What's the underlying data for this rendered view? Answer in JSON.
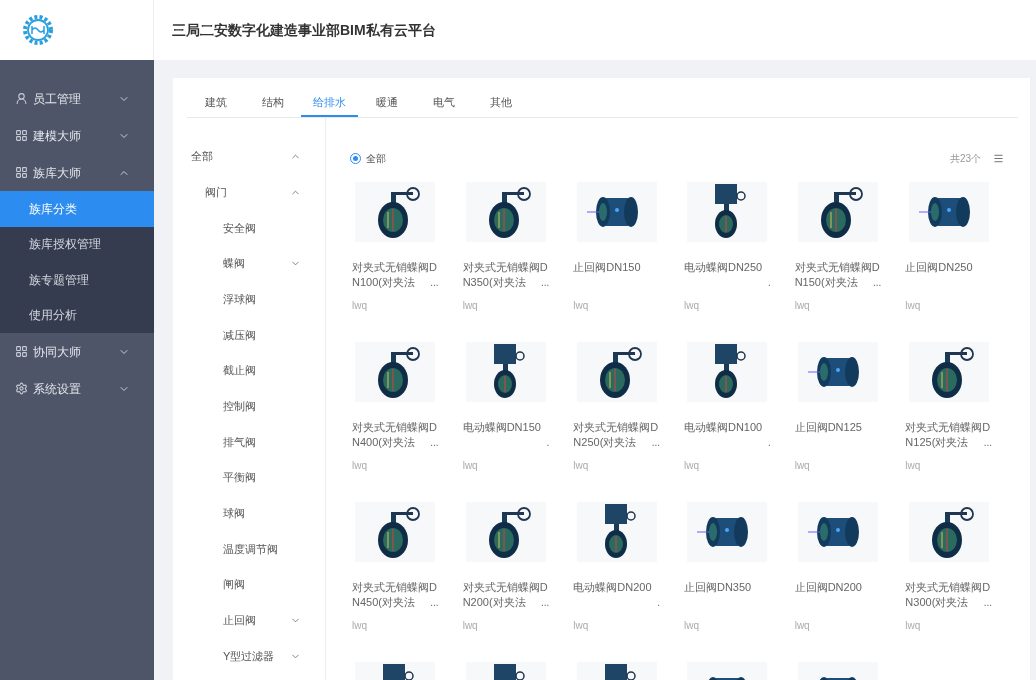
{
  "header": {
    "title": "三局二安数字化建造事业部BIM私有云平台"
  },
  "sidebar": {
    "items": [
      {
        "label": "员工管理",
        "kind": "user",
        "expanded": false
      },
      {
        "label": "建模大师",
        "kind": "grid",
        "expanded": false
      },
      {
        "label": "族库大师",
        "kind": "grid",
        "expanded": true,
        "children": [
          {
            "label": "族库分类",
            "selected": true
          },
          {
            "label": "族库授权管理",
            "selected": false
          },
          {
            "label": "族专题管理",
            "selected": false
          },
          {
            "label": "使用分析",
            "selected": false
          }
        ]
      },
      {
        "label": "协同大师",
        "kind": "grid",
        "expanded": false
      },
      {
        "label": "系统设置",
        "kind": "gear",
        "expanded": false
      }
    ]
  },
  "tabs": [
    {
      "label": "建筑",
      "selected": false
    },
    {
      "label": "结构",
      "selected": false
    },
    {
      "label": "给排水",
      "selected": true
    },
    {
      "label": "暖通",
      "selected": false
    },
    {
      "label": "电气",
      "selected": false
    },
    {
      "label": "其他",
      "selected": false
    }
  ],
  "tree": {
    "label": "全部",
    "expanded": true,
    "children": [
      {
        "label": "阀门",
        "expanded": true,
        "children": [
          {
            "label": "安全阀",
            "kind": "leaf"
          },
          {
            "label": "蝶阀",
            "kind": "group",
            "expanded": false
          },
          {
            "label": "浮球阀",
            "kind": "leaf"
          },
          {
            "label": "减压阀",
            "kind": "leaf"
          },
          {
            "label": "截止阀",
            "kind": "leaf"
          },
          {
            "label": "控制阀",
            "kind": "leaf"
          },
          {
            "label": "排气阀",
            "kind": "leaf"
          },
          {
            "label": "平衡阀",
            "kind": "leaf"
          },
          {
            "label": "球阀",
            "kind": "leaf"
          },
          {
            "label": "温度调节阀",
            "kind": "leaf"
          },
          {
            "label": "闸阀",
            "kind": "leaf"
          },
          {
            "label": "止回阀",
            "kind": "group",
            "expanded": false
          },
          {
            "label": "Y型过滤器",
            "kind": "group",
            "expanded": false
          }
        ]
      }
    ]
  },
  "filter": {
    "label": "全部",
    "selected": true
  },
  "count": "共23个",
  "items": [
    {
      "line1": "对夹式无销蝶阀D",
      "line2": "N100(对夹法",
      "more": "...",
      "author": "lwq"
    },
    {
      "line1": "对夹式无销蝶阀D",
      "line2": "N350(对夹法",
      "more": "...",
      "author": "lwq"
    },
    {
      "line1": "止回阀DN150",
      "author": "lwq"
    },
    {
      "line1": "电动蝶阀DN250",
      "more": ".",
      "author": "lwq"
    },
    {
      "line1": "对夹式无销蝶阀D",
      "line2": "N150(对夹法",
      "more": "...",
      "author": "lwq"
    },
    {
      "line1": "止回阀DN250",
      "author": "lwq"
    },
    {
      "line1": "对夹式无销蝶阀D",
      "line2": "N400(对夹法",
      "more": "...",
      "author": "lwq"
    },
    {
      "line1": "电动蝶阀DN150",
      "more": ".",
      "author": "lwq"
    },
    {
      "line1": "对夹式无销蝶阀D",
      "line2": "N250(对夹法",
      "more": "...",
      "author": "lwq"
    },
    {
      "line1": "电动蝶阀DN100",
      "more": ".",
      "author": "lwq"
    },
    {
      "line1": "止回阀DN125",
      "author": "lwq"
    },
    {
      "line1": "对夹式无销蝶阀D",
      "line2": "N125(对夹法",
      "more": "...",
      "author": "lwq"
    },
    {
      "line1": "对夹式无销蝶阀D",
      "line2": "N450(对夹法",
      "more": "...",
      "author": "lwq"
    },
    {
      "line1": "对夹式无销蝶阀D",
      "line2": "N200(对夹法",
      "more": "...",
      "author": "lwq"
    },
    {
      "line1": "电动蝶阀DN200",
      "more": ".",
      "author": "lwq"
    },
    {
      "line1": "止回阀DN350",
      "author": "lwq"
    },
    {
      "line1": "止回阀DN200",
      "author": "lwq"
    },
    {
      "line1": "对夹式无销蝶阀D",
      "line2": "N300(对夹法",
      "more": "...",
      "author": "lwq"
    }
  ]
}
